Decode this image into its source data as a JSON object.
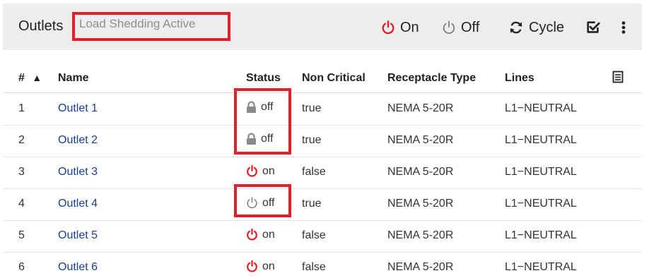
{
  "header": {
    "title": "Outlets",
    "status_badge": "Load Shedding Active",
    "actions": {
      "on_label": "On",
      "off_label": "Off",
      "cycle_label": "Cycle"
    }
  },
  "table": {
    "columns": {
      "num": "#",
      "name": "Name",
      "status": "Status",
      "non_critical": "Non Critical",
      "receptacle_type": "Receptacle Type",
      "lines": "Lines"
    },
    "sort_indicator": "▲",
    "rows": [
      {
        "num": "1",
        "name": "Outlet 1",
        "status_icon": "lock-icon",
        "status": "off",
        "non_critical": "true",
        "receptacle_type": "NEMA 5-20R",
        "lines": "L1−NEUTRAL"
      },
      {
        "num": "2",
        "name": "Outlet 2",
        "status_icon": "lock-icon",
        "status": "off",
        "non_critical": "true",
        "receptacle_type": "NEMA 5-20R",
        "lines": "L1−NEUTRAL"
      },
      {
        "num": "3",
        "name": "Outlet 3",
        "status_icon": "power-on-icon",
        "status": "on",
        "non_critical": "false",
        "receptacle_type": "NEMA 5-20R",
        "lines": "L1−NEUTRAL"
      },
      {
        "num": "4",
        "name": "Outlet 4",
        "status_icon": "power-off-icon",
        "status": "off",
        "non_critical": "true",
        "receptacle_type": "NEMA 5-20R",
        "lines": "L1−NEUTRAL"
      },
      {
        "num": "5",
        "name": "Outlet 5",
        "status_icon": "power-on-icon",
        "status": "on",
        "non_critical": "false",
        "receptacle_type": "NEMA 5-20R",
        "lines": "L1−NEUTRAL"
      },
      {
        "num": "6",
        "name": "Outlet 6",
        "status_icon": "power-on-icon",
        "status": "on",
        "non_critical": "false",
        "receptacle_type": "NEMA 5-20R",
        "lines": "L1−NEUTRAL"
      }
    ]
  },
  "colors": {
    "accent_red": "#e0202a",
    "link_blue": "#1a3f8f",
    "header_bg": "#ededed"
  }
}
